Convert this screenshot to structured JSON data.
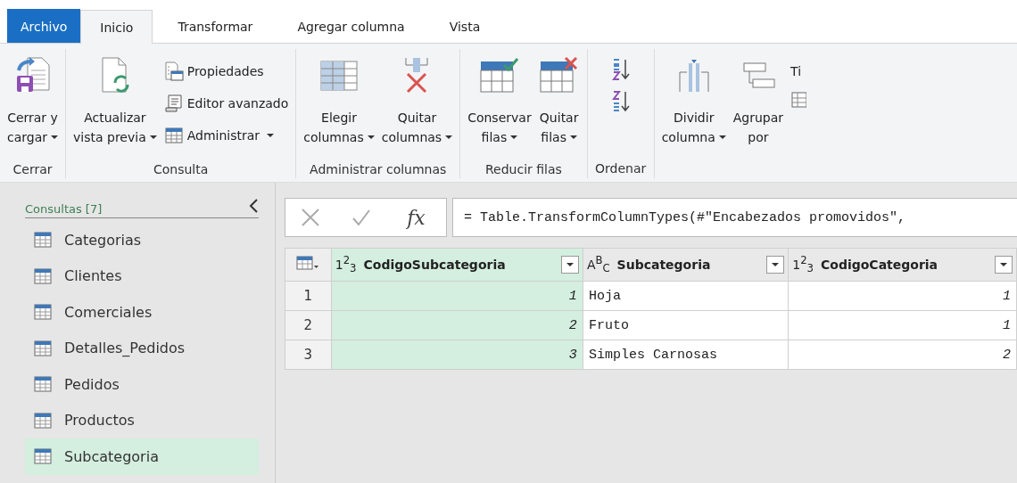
{
  "tabs": [
    {
      "label": "Archivo",
      "kind": "file",
      "selected": false
    },
    {
      "label": "Inicio",
      "kind": "tab",
      "selected": true
    },
    {
      "label": "Transformar",
      "kind": "tab",
      "selected": false
    },
    {
      "label": "Agregar columna",
      "kind": "tab",
      "selected": false
    },
    {
      "label": "Vista",
      "kind": "tab",
      "selected": false
    }
  ],
  "ribbon": {
    "groups": [
      {
        "label": "Cerrar",
        "buttons": [
          {
            "kind": "big",
            "lines": [
              "Cerrar y",
              "cargar"
            ],
            "dropdown": true
          }
        ]
      },
      {
        "label": "Consulta",
        "buttons": [
          {
            "kind": "big",
            "lines": [
              "Actualizar",
              "vista previa"
            ],
            "dropdown": true
          },
          {
            "kind": "stack",
            "items": [
              {
                "label": "Propiedades",
                "dropdown": false
              },
              {
                "label": "Editor avanzado",
                "dropdown": false
              },
              {
                "label": "Administrar",
                "dropdown": true
              }
            ]
          }
        ]
      },
      {
        "label": "Administrar columnas",
        "buttons": [
          {
            "kind": "big",
            "lines": [
              "Elegir",
              "columnas"
            ],
            "dropdown": true
          },
          {
            "kind": "big",
            "lines": [
              "Quitar",
              "columnas"
            ],
            "dropdown": true
          }
        ]
      },
      {
        "label": "Reducir filas",
        "buttons": [
          {
            "kind": "big",
            "lines": [
              "Conservar",
              "filas"
            ],
            "dropdown": true
          },
          {
            "kind": "big",
            "lines": [
              "Quitar",
              "filas"
            ],
            "dropdown": true
          }
        ]
      },
      {
        "label": "Ordenar",
        "buttons": [
          {
            "kind": "sort"
          }
        ]
      },
      {
        "buttons": [
          {
            "kind": "big",
            "lines": [
              "Dividir",
              "columna"
            ],
            "dropdown": true
          },
          {
            "kind": "big",
            "lines": [
              "Agrupar",
              "por"
            ],
            "dropdown": false
          },
          {
            "kind": "stack",
            "items": [
              {
                "label": "Ti",
                "dropdown": false
              }
            ]
          }
        ]
      }
    ]
  },
  "sidebar": {
    "title": "Consultas [7]",
    "items": [
      {
        "label": "Categorias",
        "selected": false
      },
      {
        "label": "Clientes",
        "selected": false
      },
      {
        "label": "Comerciales",
        "selected": false
      },
      {
        "label": "Detalles_Pedidos",
        "selected": false
      },
      {
        "label": "Pedidos",
        "selected": false
      },
      {
        "label": "Productos",
        "selected": false
      },
      {
        "label": "Subcategoria",
        "selected": true
      }
    ]
  },
  "formula_bar": {
    "fx_label": "fx",
    "formula": "= Table.TransformColumnTypes(#\"Encabezados promovidos\","
  },
  "table": {
    "columns": [
      {
        "type_label": "1$^{2}$$_{3}$",
        "name": "CodigoSubcategoria",
        "kind": "number",
        "selected": true
      },
      {
        "type_label": "A$^{B}$$_{C}$",
        "name": "Subcategoria",
        "kind": "text",
        "selected": false
      },
      {
        "type_label": "1$^{2}$$_{3}$",
        "name": "CodigoCategoria",
        "kind": "number",
        "selected": false
      }
    ],
    "rows": [
      {
        "number": "1",
        "cells": [
          "1",
          "Hoja",
          "1"
        ]
      },
      {
        "number": "2",
        "cells": [
          "2",
          "Fruto",
          "1"
        ]
      },
      {
        "number": "3",
        "cells": [
          "3",
          "Simples Carnosas",
          "2"
        ]
      }
    ]
  }
}
